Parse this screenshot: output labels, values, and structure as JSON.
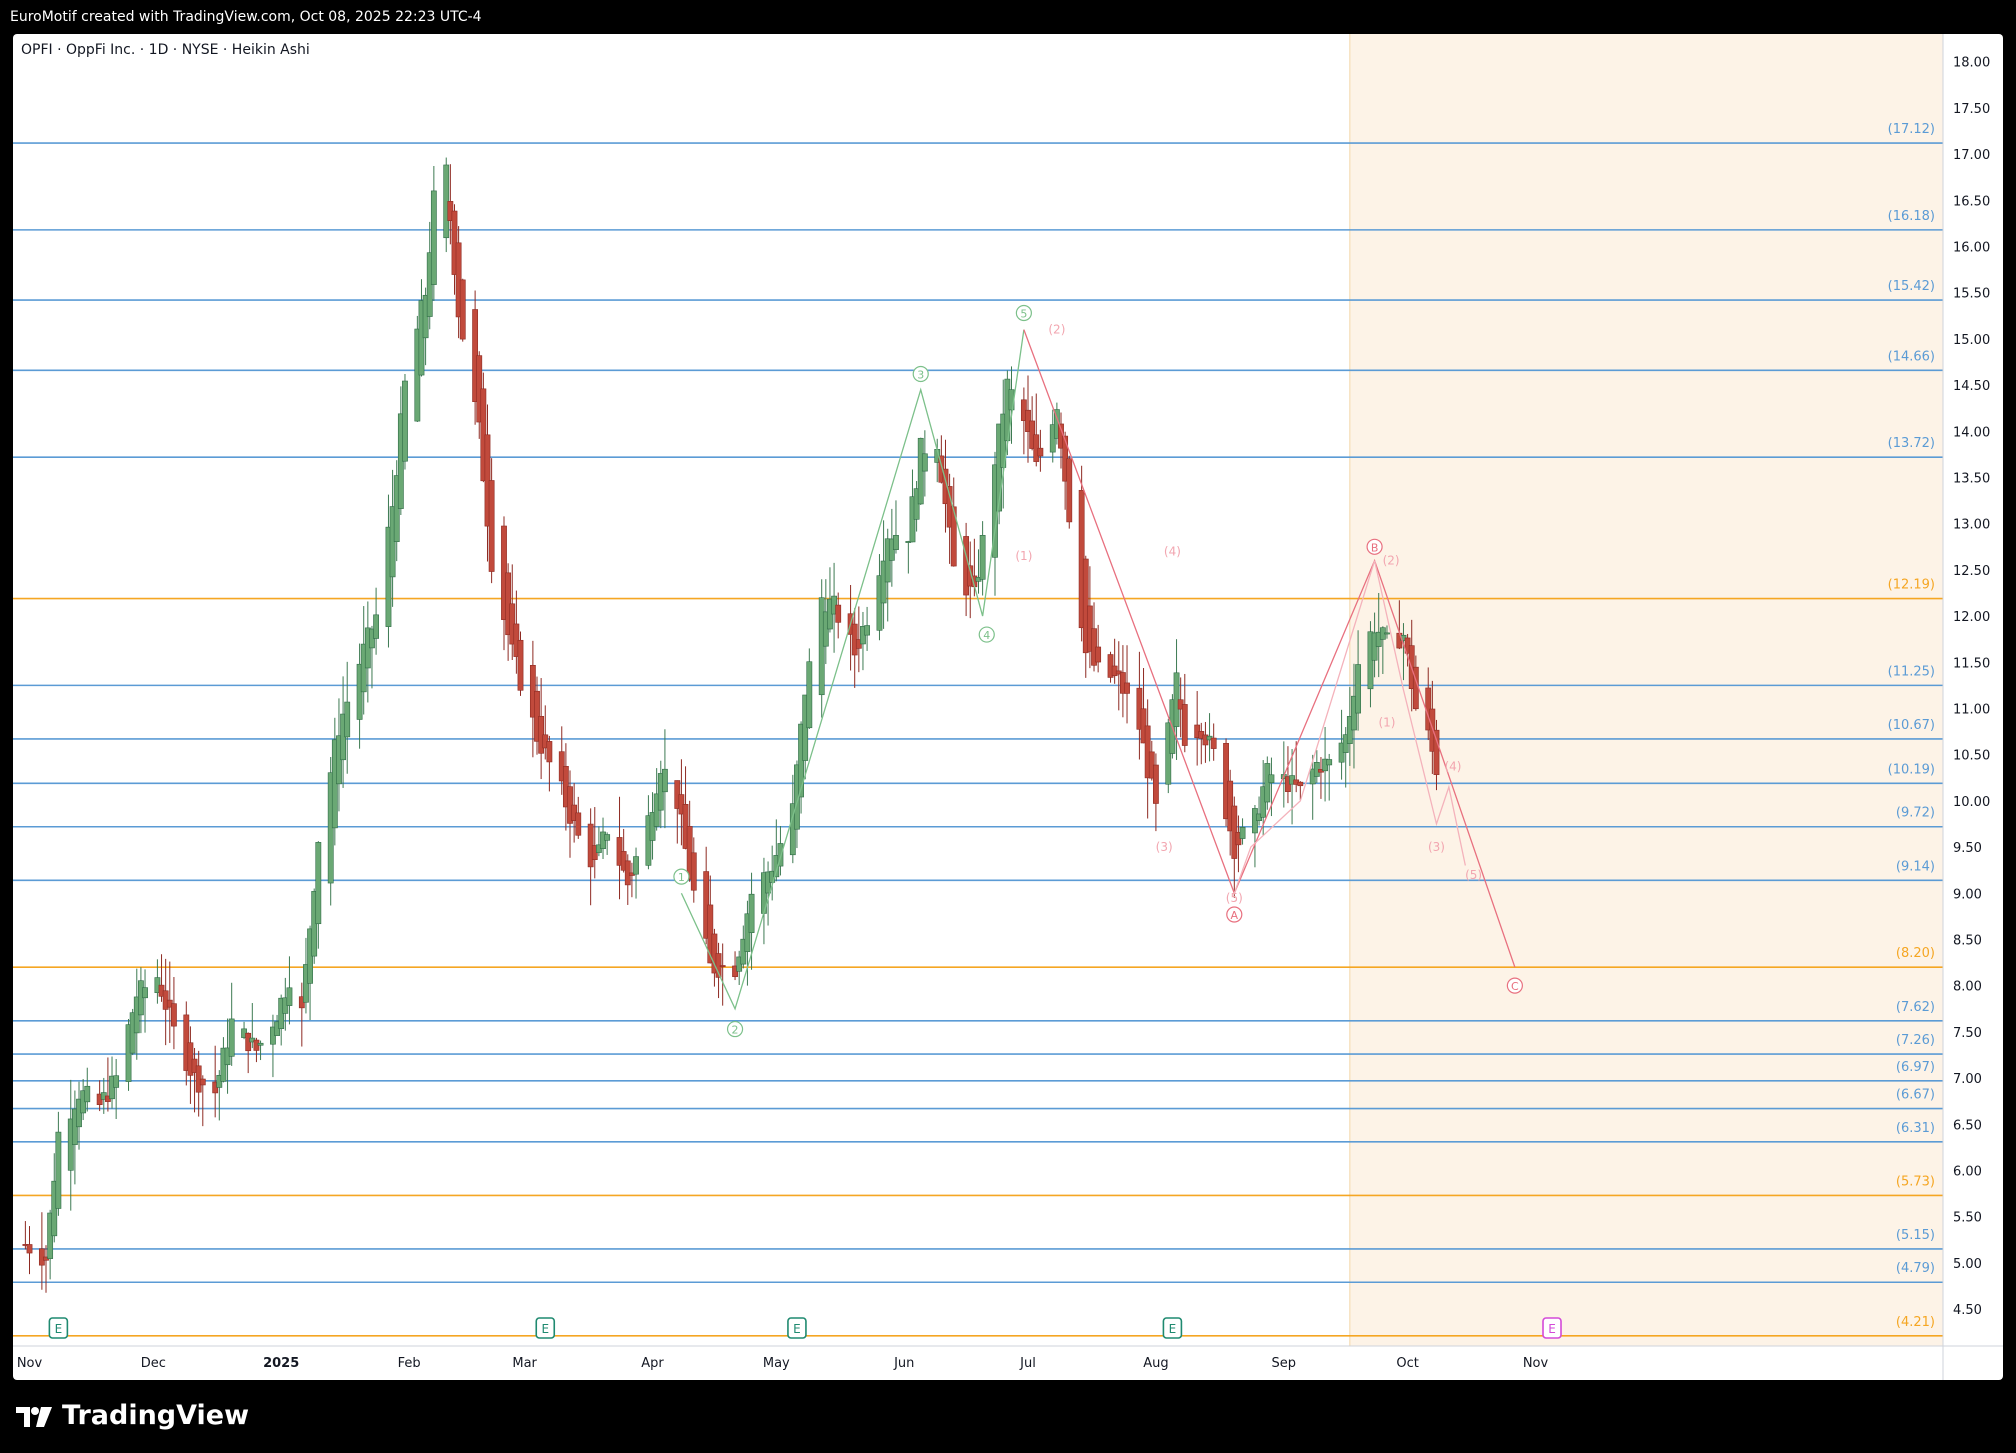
{
  "header": {
    "attribution": "EuroMotif created with TradingView.com, Oct 08, 2025 22:23 UTC-4"
  },
  "legend": {
    "text": "OPFI · OppFi Inc. · 1D · NYSE · Heikin Ashi"
  },
  "brand": {
    "name": "TradingView",
    "logo_icon": "tradingview-logo-icon"
  },
  "colors": {
    "up": "#26a69a",
    "up_fill": "#6aa874",
    "down": "#c0392b",
    "down_fill": "#c14a3c",
    "level_blue": "#5b9bd5",
    "level_orange": "#f5a623",
    "wave_green": "#7cc08a",
    "wave_red": "#e8707f",
    "shade": "#fdf3e7"
  },
  "chart_data": {
    "type": "candlestick",
    "series_style": "Heikin Ashi",
    "symbol": "OPFI",
    "interval": "1D",
    "ylim": [
      4.1,
      18.3
    ],
    "y_ticks": [
      "18.00",
      "17.50",
      "17.00",
      "16.50",
      "16.00",
      "15.50",
      "15.00",
      "14.50",
      "14.00",
      "13.50",
      "13.00",
      "12.50",
      "12.00",
      "11.50",
      "11.00",
      "10.50",
      "10.00",
      "9.50",
      "9.00",
      "8.50",
      "8.00",
      "7.50",
      "7.00",
      "6.50",
      "6.00",
      "5.50",
      "5.00",
      "4.50"
    ],
    "x_ticks": [
      {
        "label": "Nov",
        "date": "2024-11-01",
        "bold": false
      },
      {
        "label": "Dec",
        "date": "2024-12-01",
        "bold": false
      },
      {
        "label": "2025",
        "date": "2025-01-01",
        "bold": true
      },
      {
        "label": "Feb",
        "date": "2025-02-01",
        "bold": false
      },
      {
        "label": "Mar",
        "date": "2025-03-01",
        "bold": false
      },
      {
        "label": "Apr",
        "date": "2025-04-01",
        "bold": false
      },
      {
        "label": "May",
        "date": "2025-05-01",
        "bold": false
      },
      {
        "label": "Jun",
        "date": "2025-06-01",
        "bold": false
      },
      {
        "label": "Jul",
        "date": "2025-07-01",
        "bold": false
      },
      {
        "label": "Aug",
        "date": "2025-08-01",
        "bold": false
      },
      {
        "label": "Sep",
        "date": "2025-09-01",
        "bold": false
      },
      {
        "label": "Oct",
        "date": "2025-10-01",
        "bold": false
      },
      {
        "label": "Nov",
        "date": "2025-11-01",
        "bold": false
      }
    ],
    "levels": [
      {
        "value": 17.12,
        "label": "(17.12)",
        "color": "blue"
      },
      {
        "value": 16.18,
        "label": "(16.18)",
        "color": "blue"
      },
      {
        "value": 15.42,
        "label": "(15.42)",
        "color": "blue"
      },
      {
        "value": 14.66,
        "label": "(14.66)",
        "color": "blue"
      },
      {
        "value": 13.72,
        "label": "(13.72)",
        "color": "blue"
      },
      {
        "value": 12.19,
        "label": "(12.19)",
        "color": "orange"
      },
      {
        "value": 11.25,
        "label": "(11.25)",
        "color": "blue"
      },
      {
        "value": 10.67,
        "label": "(10.67)",
        "color": "blue"
      },
      {
        "value": 10.19,
        "label": "(10.19)",
        "color": "blue"
      },
      {
        "value": 9.72,
        "label": "(9.72)",
        "color": "blue"
      },
      {
        "value": 9.14,
        "label": "(9.14)",
        "color": "blue"
      },
      {
        "value": 8.2,
        "label": "(8.20)",
        "color": "orange"
      },
      {
        "value": 7.62,
        "label": "(7.62)",
        "color": "blue"
      },
      {
        "value": 7.26,
        "label": "(7.26)",
        "color": "blue"
      },
      {
        "value": 6.97,
        "label": "(6.97)",
        "color": "blue"
      },
      {
        "value": 6.67,
        "label": "(6.67)",
        "color": "blue"
      },
      {
        "value": 6.31,
        "label": "(6.31)",
        "color": "blue"
      },
      {
        "value": 5.73,
        "label": "(5.73)",
        "color": "orange"
      },
      {
        "value": 5.15,
        "label": "(5.15)",
        "color": "blue"
      },
      {
        "value": 4.79,
        "label": "(4.79)",
        "color": "blue"
      },
      {
        "value": 4.21,
        "label": "(4.21)",
        "color": "orange"
      }
    ],
    "shaded_region": {
      "from": "2025-09-17",
      "to": "2026-01-01"
    },
    "earnings_markers": [
      {
        "date": "2024-11-08",
        "label": "E",
        "color": "green"
      },
      {
        "date": "2025-03-06",
        "label": "E",
        "color": "green"
      },
      {
        "date": "2025-05-06",
        "label": "E",
        "color": "green"
      },
      {
        "date": "2025-08-05",
        "label": "E",
        "color": "green"
      },
      {
        "date": "2025-11-05",
        "label": "E",
        "color": "magenta"
      }
    ],
    "wave_paths": [
      {
        "name": "impulse",
        "color": "green",
        "points": [
          [
            "2025-04-08",
            9.0
          ],
          [
            "2025-04-21",
            7.75
          ],
          [
            "2025-06-05",
            14.45
          ],
          [
            "2025-06-20",
            12.0
          ],
          [
            "2025-06-30",
            15.1
          ]
        ]
      },
      {
        "name": "correction-abc",
        "color": "red",
        "points": [
          [
            "2025-06-30",
            15.1
          ],
          [
            "2025-08-20",
            9.0
          ],
          [
            "2025-09-23",
            12.6
          ],
          [
            "2025-10-27",
            8.2
          ]
        ]
      },
      {
        "name": "sub-b",
        "color": "red-light",
        "points": [
          [
            "2025-08-20",
            9.0
          ],
          [
            "2025-08-24",
            9.5
          ],
          [
            "2025-09-05",
            10.0
          ],
          [
            "2025-09-23",
            12.6
          ]
        ]
      },
      {
        "name": "sub-c",
        "color": "red-light",
        "points": [
          [
            "2025-09-23",
            12.6
          ],
          [
            "2025-09-30",
            11.2
          ],
          [
            "2025-10-08",
            9.75
          ],
          [
            "2025-10-11",
            10.15
          ],
          [
            "2025-10-15",
            9.3
          ]
        ]
      }
    ],
    "wave_labels": [
      {
        "text": "1",
        "date": "2025-04-08",
        "value": 9.18,
        "circled": true,
        "color": "green"
      },
      {
        "text": "2",
        "date": "2025-04-21",
        "value": 7.53,
        "circled": true,
        "color": "green"
      },
      {
        "text": "3",
        "date": "2025-06-05",
        "value": 14.62,
        "circled": true,
        "color": "green"
      },
      {
        "text": "4",
        "date": "2025-06-21",
        "value": 11.8,
        "circled": true,
        "color": "green"
      },
      {
        "text": "5",
        "date": "2025-06-30",
        "value": 15.28,
        "circled": true,
        "color": "green"
      },
      {
        "text": "(1)",
        "date": "2025-06-30",
        "value": 12.65,
        "circled": false,
        "color": "red-light"
      },
      {
        "text": "(2)",
        "date": "2025-07-08",
        "value": 15.1,
        "circled": false,
        "color": "red-light"
      },
      {
        "text": "(3)",
        "date": "2025-08-03",
        "value": 9.5,
        "circled": false,
        "color": "red-light"
      },
      {
        "text": "(4)",
        "date": "2025-08-05",
        "value": 12.7,
        "circled": false,
        "color": "red-light"
      },
      {
        "text": "(5)",
        "date": "2025-08-20",
        "value": 8.95,
        "circled": false,
        "color": "red-light"
      },
      {
        "text": "A",
        "date": "2025-08-20",
        "value": 8.77,
        "circled": true,
        "color": "red"
      },
      {
        "text": "B",
        "date": "2025-09-23",
        "value": 12.75,
        "circled": true,
        "color": "red"
      },
      {
        "text": "(1)",
        "date": "2025-09-26",
        "value": 10.85,
        "circled": false,
        "color": "red-light"
      },
      {
        "text": "(2)",
        "date": "2025-09-27",
        "value": 12.6,
        "circled": false,
        "color": "red-light"
      },
      {
        "text": "(3)",
        "date": "2025-10-08",
        "value": 9.5,
        "circled": false,
        "color": "red-light"
      },
      {
        "text": "(4)",
        "date": "2025-10-12",
        "value": 10.37,
        "circled": false,
        "color": "red-light"
      },
      {
        "text": "(5)",
        "date": "2025-10-17",
        "value": 9.2,
        "circled": false,
        "color": "red-light"
      },
      {
        "text": "C",
        "date": "2025-10-27",
        "value": 8.0,
        "circled": true,
        "color": "red"
      }
    ],
    "anchors": [
      [
        "2024-10-31",
        5.2
      ],
      [
        "2024-11-05",
        5.05
      ],
      [
        "2024-11-08",
        6.4
      ],
      [
        "2024-11-13",
        6.85
      ],
      [
        "2024-11-18",
        6.7
      ],
      [
        "2024-11-22",
        7.0
      ],
      [
        "2024-11-27",
        7.9
      ],
      [
        "2024-12-02",
        8.1
      ],
      [
        "2024-12-06",
        7.5
      ],
      [
        "2024-12-11",
        7.0
      ],
      [
        "2024-12-16",
        6.85
      ],
      [
        "2024-12-20",
        7.6
      ],
      [
        "2024-12-26",
        7.3
      ],
      [
        "2024-12-31",
        7.7
      ],
      [
        "2025-01-03",
        8.1
      ],
      [
        "2025-01-06",
        7.7
      ],
      [
        "2025-01-10",
        9.6
      ],
      [
        "2025-01-15",
        10.8
      ],
      [
        "2025-01-20",
        11.5
      ],
      [
        "2025-01-24",
        12.0
      ],
      [
        "2025-01-28",
        13.2
      ],
      [
        "2025-01-31",
        14.5
      ],
      [
        "2025-02-05",
        15.5
      ],
      [
        "2025-02-07",
        16.5
      ],
      [
        "2025-02-10",
        16.8
      ],
      [
        "2025-02-13",
        15.3
      ],
      [
        "2025-02-18",
        14.0
      ],
      [
        "2025-02-21",
        12.6
      ],
      [
        "2025-02-26",
        11.6
      ],
      [
        "2025-03-04",
        10.7
      ],
      [
        "2025-03-10",
        10.1
      ],
      [
        "2025-03-14",
        9.6
      ],
      [
        "2025-03-18",
        9.3
      ],
      [
        "2025-03-21",
        9.7
      ],
      [
        "2025-03-26",
        9.1
      ],
      [
        "2025-03-31",
        9.8
      ],
      [
        "2025-04-03",
        10.4
      ],
      [
        "2025-04-07",
        10.0
      ],
      [
        "2025-04-10",
        9.2
      ],
      [
        "2025-04-15",
        8.2
      ],
      [
        "2025-04-21",
        8.2
      ],
      [
        "2025-04-25",
        9.0
      ],
      [
        "2025-04-30",
        9.3
      ],
      [
        "2025-05-05",
        9.9
      ],
      [
        "2025-05-08",
        11.2
      ],
      [
        "2025-05-12",
        12.2
      ],
      [
        "2025-05-15",
        12.1
      ],
      [
        "2025-05-20",
        11.6
      ],
      [
        "2025-05-23",
        12.0
      ],
      [
        "2025-05-28",
        12.9
      ],
      [
        "2025-06-02",
        12.9
      ],
      [
        "2025-06-05",
        13.8
      ],
      [
        "2025-06-09",
        13.9
      ],
      [
        "2025-06-13",
        12.5
      ],
      [
        "2025-06-18",
        12.2
      ],
      [
        "2025-06-23",
        13.7
      ],
      [
        "2025-06-26",
        14.5
      ],
      [
        "2025-06-30",
        14.1
      ],
      [
        "2025-07-03",
        13.6
      ],
      [
        "2025-07-08",
        14.3
      ],
      [
        "2025-07-11",
        13.1
      ],
      [
        "2025-07-15",
        11.6
      ],
      [
        "2025-07-18",
        11.4
      ],
      [
        "2025-07-23",
        11.3
      ],
      [
        "2025-07-28",
        10.8
      ],
      [
        "2025-08-01",
        9.9
      ],
      [
        "2025-08-06",
        11.3
      ],
      [
        "2025-08-08",
        10.7
      ],
      [
        "2025-08-12",
        10.8
      ],
      [
        "2025-08-15",
        10.5
      ],
      [
        "2025-08-20",
        9.5
      ],
      [
        "2025-08-25",
        9.8
      ],
      [
        "2025-08-28",
        10.3
      ],
      [
        "2025-09-02",
        10.2
      ],
      [
        "2025-09-05",
        10.1
      ],
      [
        "2025-09-09",
        10.4
      ],
      [
        "2025-09-12",
        10.4
      ],
      [
        "2025-09-16",
        10.7
      ],
      [
        "2025-09-19",
        11.5
      ],
      [
        "2025-09-23",
        11.9
      ],
      [
        "2025-09-26",
        11.7
      ],
      [
        "2025-09-30",
        11.8
      ],
      [
        "2025-10-03",
        11.0
      ],
      [
        "2025-10-06",
        10.7
      ],
      [
        "2025-10-08",
        10.35
      ]
    ]
  }
}
